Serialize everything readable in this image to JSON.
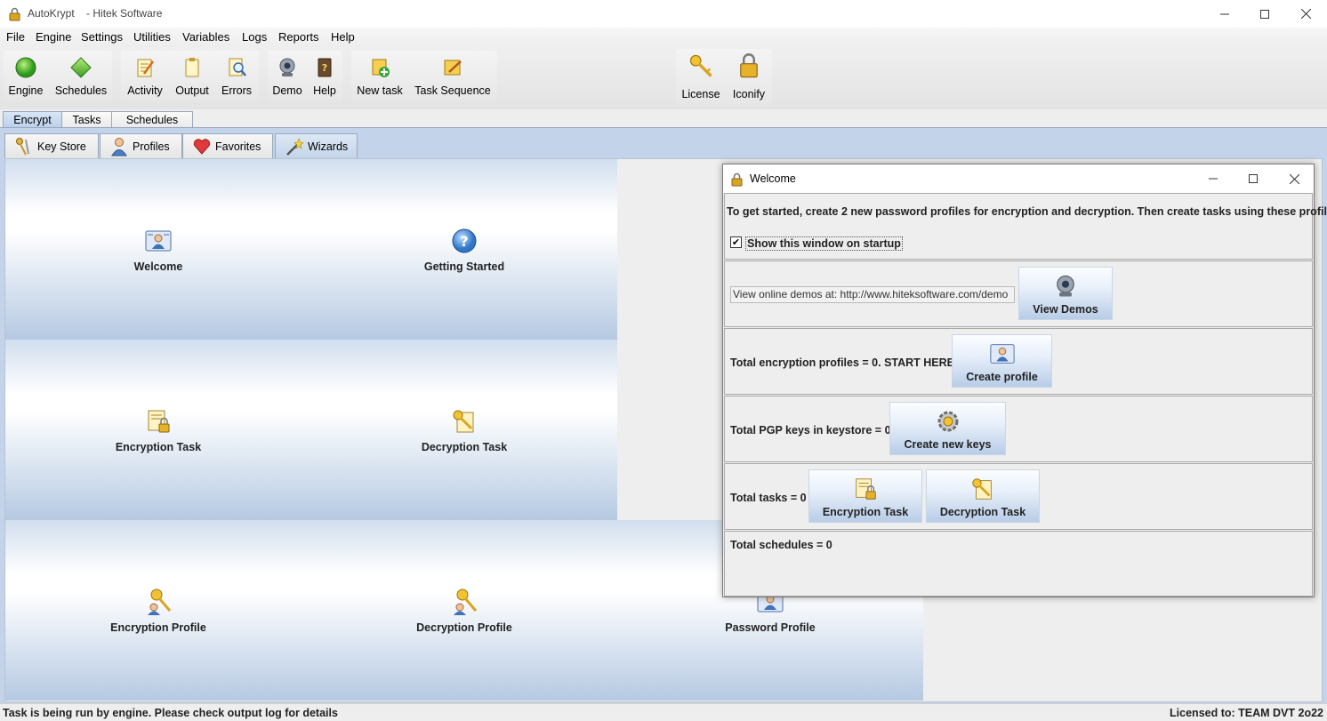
{
  "window": {
    "app_name": "AutoKrypt",
    "title_suffix": "- Hitek Software"
  },
  "menu": [
    {
      "label": "File"
    },
    {
      "label": "Engine"
    },
    {
      "label": "Settings"
    },
    {
      "label": "Utilities"
    },
    {
      "label": "Variables"
    },
    {
      "label": "Logs"
    },
    {
      "label": "Reports"
    },
    {
      "label": "Help"
    }
  ],
  "toolbar": {
    "engine": "Engine",
    "schedules": "Schedules",
    "activity": "Activity",
    "output": "Output",
    "errors": "Errors",
    "demo": "Demo",
    "help": "Help",
    "new_task": "New task",
    "task_sequence": "Task Sequence",
    "license": "License",
    "iconify": "Iconify"
  },
  "main_tabs": [
    "Encrypt",
    "Tasks",
    "Schedules"
  ],
  "sub_tabs": [
    "Key Store",
    "Profiles",
    "Favorites",
    "Wizards"
  ],
  "wizards": [
    {
      "label": "Welcome",
      "icon": "profile-card-icon"
    },
    {
      "label": "Getting Started",
      "icon": "question-icon"
    },
    {
      "label": "Encryption Task",
      "icon": "encryption-task-icon"
    },
    {
      "label": "Decryption Task",
      "icon": "decryption-task-icon"
    },
    {
      "label": "Encryption Profile",
      "icon": "encryption-profile-icon"
    },
    {
      "label": "Decryption Profile",
      "icon": "decryption-profile-icon"
    },
    {
      "label": "Password Profile",
      "icon": "password-profile-icon"
    }
  ],
  "welcome": {
    "title": "Welcome",
    "intro": "To get started, create 2 new password profiles for encryption and decryption.  Then create tasks using these profiles",
    "show_on_startup": "Show this window on startup",
    "demo_url": "View online demos at: http://www.hiteksoftware.com/demo",
    "view_demos": "View Demos",
    "profiles_text": "Total encryption profiles = 0.  START HERE",
    "create_profile": "Create profile",
    "pgp_text": "Total PGP keys in keystore = 0",
    "create_keys": "Create new keys",
    "tasks_text": "Total tasks = 0",
    "encryption_task": "Encryption Task",
    "decryption_task": "Decryption Task",
    "schedules_text": "Total schedules = 0"
  },
  "status": {
    "left": "Task is being run by engine.  Please check output log for details",
    "right": "Licensed to: TEAM DVT 2o22"
  }
}
